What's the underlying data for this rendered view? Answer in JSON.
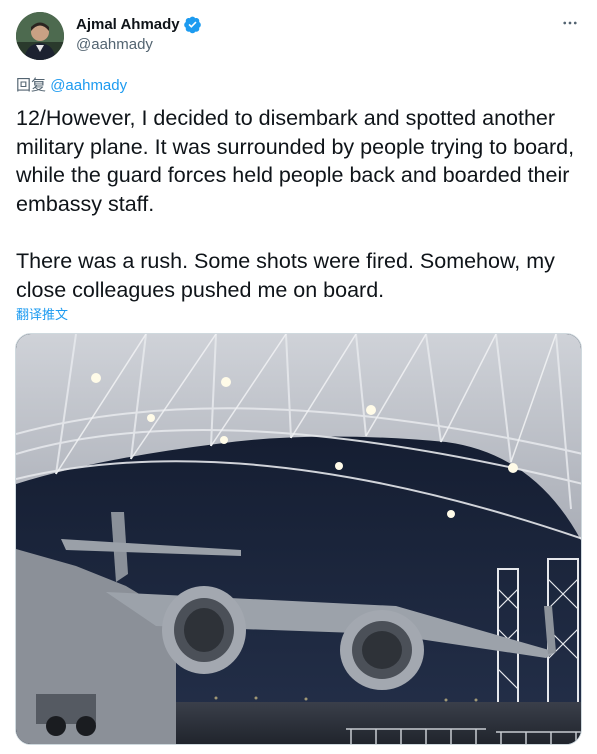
{
  "author": {
    "display_name": "Ajmal Ahmady",
    "handle": "@aahmady",
    "verified": true,
    "avatar_icon": "profile-photo",
    "verified_icon": "verified-badge-icon"
  },
  "more_icon": "more-horizontal-icon",
  "reply": {
    "prefix": "回复",
    "handle": "@aahmady"
  },
  "tweet": {
    "text": "12/However, I decided to disembark and spotted another military plane. It was surrounded by people trying to board, while the guard forces held people back and boarded their embassy staff.\n\nThere was a rush. Some shots were fired. Somehow, my close colleagues pushed me on board."
  },
  "translate_label": "翻译推文",
  "media": {
    "type": "photo",
    "subject": "military-transport-plane-in-hangar"
  },
  "colors": {
    "accent": "#1d9bf0",
    "text_primary": "#0f1419",
    "text_secondary": "#536471"
  }
}
